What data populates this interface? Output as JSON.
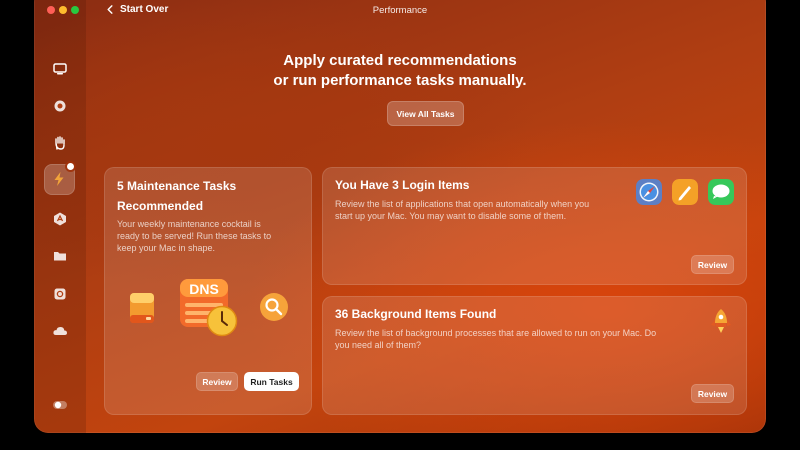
{
  "window": {
    "title": "Performance",
    "back_label": "Start Over"
  },
  "sidebar": {
    "items": [
      {
        "icon": "monitor-icon"
      },
      {
        "icon": "protection-icon"
      },
      {
        "icon": "hand-privacy-icon"
      },
      {
        "icon": "lightning-performance-icon",
        "active": true
      },
      {
        "icon": "applications-icon"
      },
      {
        "icon": "folder-icon"
      },
      {
        "icon": "disk-icon"
      },
      {
        "icon": "cloud-icon"
      },
      {
        "icon": "assistant-toggle-icon"
      }
    ]
  },
  "hero": {
    "line1": "Apply curated recommendations",
    "line2": "or run performance tasks manually.",
    "view_all_label": "View All Tasks"
  },
  "maintenance": {
    "title_line1": "5 Maintenance Tasks",
    "title_line2": "Recommended",
    "description_line1": "Your weekly maintenance cocktail is",
    "description_line2": "ready to be served! Run these tasks to",
    "description_line3": "keep your Mac in shape.",
    "dns_label": "DNS",
    "review_label": "Review",
    "run_label": "Run Tasks"
  },
  "login_items": {
    "title": "You Have 3 Login Items",
    "description_line1": "Review the list of applications that open automatically when you",
    "description_line2": "start up your Mac. You may want to disable some of them.",
    "apps": [
      "safari-app-icon",
      "pages-app-icon",
      "messages-app-icon"
    ],
    "review_label": "Review"
  },
  "background_items": {
    "title": "36 Background Items Found",
    "description_line1": "Review the list of background processes that are allowed to run on your Mac. Do",
    "description_line2": "you need all of them?",
    "review_label": "Review"
  },
  "colors": {
    "accent_orange": "#f2a43a",
    "close": "#ff5f57",
    "minimize": "#febc2e",
    "zoom": "#28c840"
  }
}
